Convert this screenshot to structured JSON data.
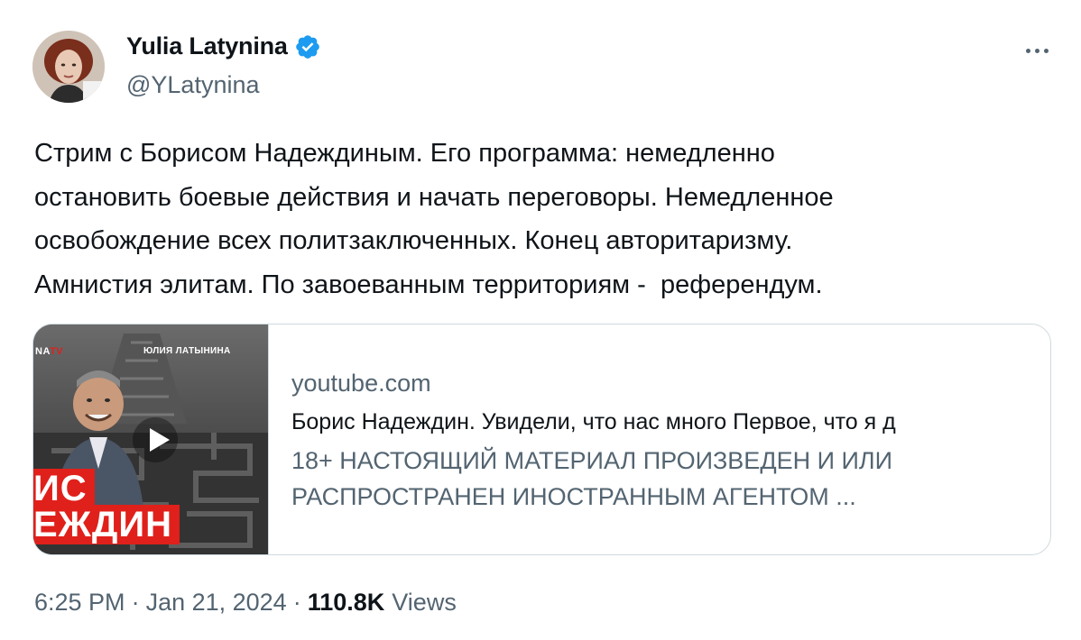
{
  "author": {
    "name": "Yulia Latynina",
    "handle": "@YLatynina",
    "verified_icon": "verified-badge-icon",
    "verified_color": "#1d9bf0"
  },
  "more_icon": "more-horizontal-icon",
  "tweet": {
    "lines": [
      "Стрим с Борисом Надеждиным. Его программа: немедленно",
      "остановить боевые действия и начать переговоры. Немедленное",
      "освобождение всех политзаключенных. Конец авторитаризму.",
      "Амнистия элитам. По завоеванным территориям -  референдум."
    ]
  },
  "card": {
    "domain": "youtube.com",
    "title": "Борис Надеждин. Увидели, что нас много Первое, что я д",
    "description_lines": [
      "18+ НАСТОЯЩИЙ МАТЕРИАЛ ПРОИЗВЕДЕН И ИЛИ",
      "РАСПРОСТРАНЕН ИНОСТРАННЫМ АГЕНТОМ ..."
    ],
    "thumbnail": {
      "brand": "NA",
      "brand_tv": "TV",
      "channel": "ЮЛИЯ ЛАТЫНИНА",
      "name_line1": "ИС",
      "name_line2": "ЕЖДИН",
      "play_icon": "play-icon"
    }
  },
  "meta": {
    "time": "6:25 PM",
    "separator": "·",
    "date": "Jan 21, 2024",
    "views_count": "110.8K",
    "views_label": "Views"
  },
  "colors": {
    "text": "#0f1419",
    "secondary": "#536471",
    "border": "#cfd9de",
    "accent_red": "#e0201b"
  }
}
